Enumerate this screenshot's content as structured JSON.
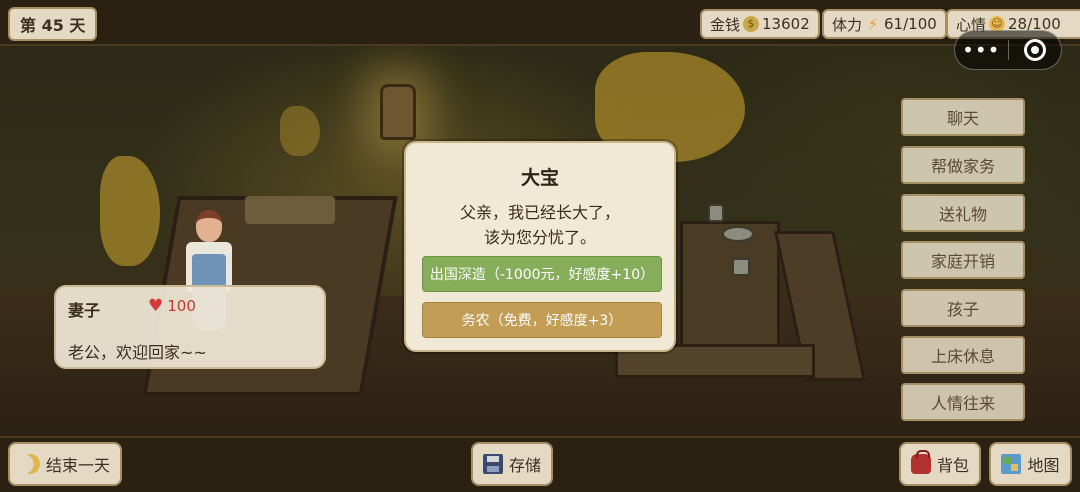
{
  "status": {
    "day": "第 45 天",
    "money_label": "金钱",
    "money_value": "13602",
    "stamina_label": "体力",
    "stamina_value": "61/100",
    "mood_label": "心情",
    "mood_value": "28/100"
  },
  "capsule": {
    "more": "•••"
  },
  "actions": [
    "聊天",
    "帮做家务",
    "送礼物",
    "家庭开销",
    "孩子",
    "上床休息",
    "人情往来"
  ],
  "wife": {
    "name": "妻子",
    "affection": "100",
    "line": "老公，欢迎回家~~"
  },
  "modal": {
    "title": "大宝",
    "message_line1": "父亲，我已经长大了，",
    "message_line2": "该为您分忧了。",
    "option1": "出国深造（-1000元，好感度+10）",
    "option2": "务农（免费，好感度+3）"
  },
  "bottom": {
    "end_day": "结束一天",
    "save": "存储",
    "bag": "背包",
    "map": "地图"
  },
  "colors": {
    "panel": "#e4dac3",
    "option_green": "#86ae5a",
    "option_gold": "#c39c55",
    "heart": "#d43c3c"
  }
}
